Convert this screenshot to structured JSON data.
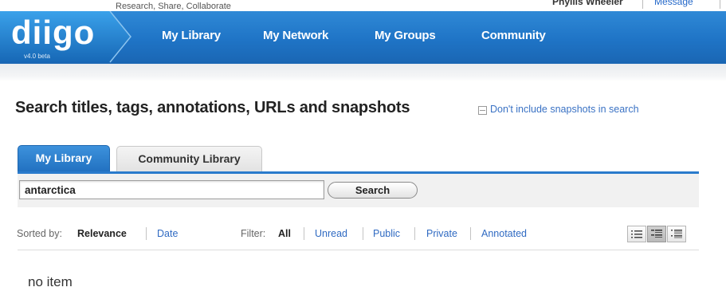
{
  "top": {
    "tagline": "Research, Share, Collaborate",
    "username": "Phyllis Wheeler",
    "message_link": "Message"
  },
  "logo": {
    "wordmark": "diigo",
    "version": "v4.0 beta"
  },
  "nav": {
    "items": [
      {
        "label": "My Library"
      },
      {
        "label": "My Network"
      },
      {
        "label": "My Groups"
      },
      {
        "label": "Community"
      }
    ]
  },
  "search": {
    "heading": "Search titles, tags, annotations, URLs and snapshots",
    "exclude_snapshots_label": "Don't include snapshots in search",
    "tabs": [
      {
        "label": "My Library",
        "active": true
      },
      {
        "label": "Community Library",
        "active": false
      }
    ],
    "query": "antarctica",
    "button_label": "Search"
  },
  "sort": {
    "label": "Sorted by:",
    "options": [
      "Relevance",
      "Date"
    ],
    "selected": "Relevance"
  },
  "filter": {
    "label": "Filter:",
    "options": [
      "All",
      "Unread",
      "Public",
      "Private",
      "Annotated"
    ],
    "selected": "All"
  },
  "view_modes": {
    "icons": [
      "compact-list-icon",
      "medium-list-icon",
      "detailed-list-icon"
    ],
    "selected": "medium-list-icon"
  },
  "results": {
    "empty_text": "no item"
  },
  "colors": {
    "nav_blue": "#1f74c6",
    "link_blue": "#2f6ac2",
    "tab_rule": "#2a7bcc"
  }
}
